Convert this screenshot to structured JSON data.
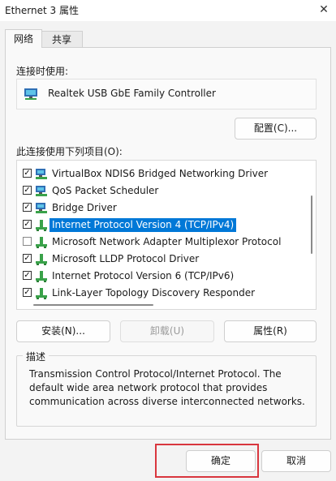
{
  "window": {
    "title": "Ethernet 3 属性",
    "close_glyph": "✕"
  },
  "tabs": [
    {
      "label": "网络",
      "active": true
    },
    {
      "label": "共享",
      "active": false
    }
  ],
  "connect_using": {
    "label": "连接时使用:",
    "adapter": "Realtek USB GbE Family Controller",
    "icon": "network-adapter-icon"
  },
  "buttons": {
    "configure": "配置(C)...",
    "install": "安装(N)...",
    "uninstall": "卸载(U)",
    "properties": "属性(R)",
    "ok": "确定",
    "cancel": "取消"
  },
  "items_label": "此连接使用下列项目(O):",
  "items": [
    {
      "label": "VirtualBox NDIS6 Bridged Networking Driver",
      "checked": true,
      "icon": "network-component-icon",
      "selected": false
    },
    {
      "label": "QoS Packet Scheduler",
      "checked": true,
      "icon": "network-component-icon",
      "selected": false
    },
    {
      "label": "Bridge Driver",
      "checked": true,
      "icon": "network-component-icon",
      "selected": false
    },
    {
      "label": "Internet Protocol Version 4 (TCP/IPv4)",
      "checked": true,
      "icon": "protocol-icon",
      "selected": true
    },
    {
      "label": "Microsoft Network Adapter Multiplexor Protocol",
      "checked": false,
      "icon": "protocol-icon",
      "selected": false
    },
    {
      "label": "Microsoft LLDP Protocol Driver",
      "checked": true,
      "icon": "protocol-icon",
      "selected": false
    },
    {
      "label": "Internet Protocol Version 6 (TCP/IPv6)",
      "checked": true,
      "icon": "protocol-icon",
      "selected": false
    },
    {
      "label": "Link-Layer Topology Discovery Responder",
      "checked": true,
      "icon": "protocol-icon",
      "selected": false
    }
  ],
  "description": {
    "legend": "描述",
    "text": "Transmission Control Protocol/Internet Protocol. The default wide area network protocol that provides communication across diverse interconnected networks."
  },
  "colors": {
    "selection": "#0078d7",
    "highlight_box": "#d9363e"
  }
}
